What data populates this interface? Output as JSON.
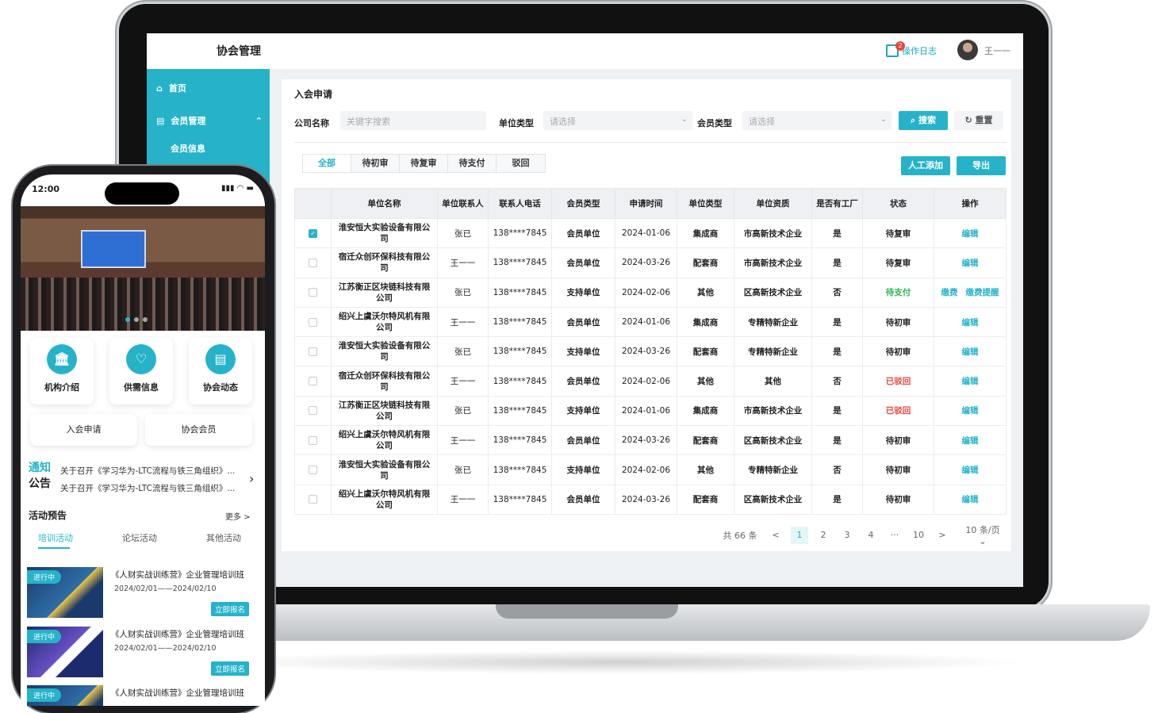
{
  "app": {
    "title": "协会管理",
    "log_label": "操作日志",
    "log_badge": "2",
    "user": "王一一"
  },
  "sidebar": {
    "items": [
      {
        "label": "首页"
      },
      {
        "label": "会员管理"
      }
    ],
    "sub": "会员信息"
  },
  "panel": {
    "title": "入会申请",
    "filters": {
      "company_label": "公司名称",
      "company_placeholder": "关键字搜索",
      "unit_type_label": "单位类型",
      "unit_type_placeholder": "请选择",
      "member_type_label": "会员类型",
      "member_type_placeholder": "请选择"
    },
    "search_label": "搜索",
    "reset_label": "重置",
    "add_label": "人工添加",
    "export_label": "导出",
    "tabs": [
      "全部",
      "待初审",
      "待复审",
      "待支付",
      "驳回"
    ],
    "columns": [
      "单位名称",
      "单位联系人",
      "联系人电话",
      "会员类型",
      "申请时间",
      "单位类型",
      "单位资质",
      "是否有工厂",
      "状态",
      "操作"
    ],
    "rows": [
      {
        "checked": true,
        "name": "淮安恒大实验设备有限公司",
        "contact": "张已",
        "phone": "138****7845",
        "member": "会员单位",
        "date": "2024-01-06",
        "utype": "集成商",
        "qual": "市高新技术企业",
        "factory": "是",
        "status": "待复审",
        "status_color": "",
        "ops": [
          "编辑"
        ]
      },
      {
        "checked": false,
        "name": "宿迁众创环保科技有限公司",
        "contact": "王一一",
        "phone": "138****7845",
        "member": "会员单位",
        "date": "2024-03-26",
        "utype": "配套商",
        "qual": "市高新技术企业",
        "factory": "是",
        "status": "待复审",
        "status_color": "",
        "ops": [
          "编辑"
        ]
      },
      {
        "checked": false,
        "name": "江苏衡正区块链科技有限公司",
        "contact": "张已",
        "phone": "138****7845",
        "member": "支持单位",
        "date": "2024-02-06",
        "utype": "其他",
        "qual": "区高新技术企业",
        "factory": "否",
        "status": "待支付",
        "status_color": "green",
        "ops": [
          "缴费",
          "缴费提醒"
        ]
      },
      {
        "checked": false,
        "name": "绍兴上虞沃尔特风机有限公司",
        "contact": "王一一",
        "phone": "138****7845",
        "member": "会员单位",
        "date": "2024-01-06",
        "utype": "集成商",
        "qual": "专精特新企业",
        "factory": "是",
        "status": "待初审",
        "status_color": "",
        "ops": [
          "编辑"
        ]
      },
      {
        "checked": false,
        "name": "淮安恒大实验设备有限公司",
        "contact": "张已",
        "phone": "138****7845",
        "member": "支持单位",
        "date": "2024-03-26",
        "utype": "配套商",
        "qual": "专精特新企业",
        "factory": "是",
        "status": "待初审",
        "status_color": "",
        "ops": [
          "编辑"
        ]
      },
      {
        "checked": false,
        "name": "宿迁众创环保科技有限公司",
        "contact": "王一一",
        "phone": "138****7845",
        "member": "会员单位",
        "date": "2024-02-06",
        "utype": "其他",
        "qual": "其他",
        "factory": "否",
        "status": "已驳回",
        "status_color": "red",
        "ops": [
          "编辑"
        ]
      },
      {
        "checked": false,
        "name": "江苏衡正区块链科技有限公司",
        "contact": "张已",
        "phone": "138****7845",
        "member": "支持单位",
        "date": "2024-01-06",
        "utype": "集成商",
        "qual": "市高新技术企业",
        "factory": "是",
        "status": "已驳回",
        "status_color": "red",
        "ops": [
          "编辑"
        ]
      },
      {
        "checked": false,
        "name": "绍兴上虞沃尔特风机有限公司",
        "contact": "王一一",
        "phone": "138****7845",
        "member": "会员单位",
        "date": "2024-03-26",
        "utype": "配套商",
        "qual": "区高新技术企业",
        "factory": "是",
        "status": "待初审",
        "status_color": "",
        "ops": [
          "编辑"
        ]
      },
      {
        "checked": false,
        "name": "淮安恒大实验设备有限公司",
        "contact": "张已",
        "phone": "138****7845",
        "member": "支持单位",
        "date": "2024-02-06",
        "utype": "其他",
        "qual": "专精特新企业",
        "factory": "否",
        "status": "待初审",
        "status_color": "",
        "ops": [
          "编辑"
        ]
      },
      {
        "checked": false,
        "name": "绍兴上虞沃尔特风机有限公司",
        "contact": "王一一",
        "phone": "138****7845",
        "member": "会员单位",
        "date": "2024-03-26",
        "utype": "配套商",
        "qual": "区高新技术企业",
        "factory": "是",
        "status": "待初审",
        "status_color": "",
        "ops": [
          "编辑"
        ]
      }
    ],
    "pager": {
      "total": "共 66 条",
      "prev": "<",
      "pages": [
        "1",
        "2",
        "3",
        "4",
        "···",
        "10"
      ],
      "next": ">",
      "size": "10 条/页"
    }
  },
  "phone": {
    "time": "12:00",
    "quick": [
      {
        "label": "机构介绍"
      },
      {
        "label": "供需信息"
      },
      {
        "label": "协会动态"
      }
    ],
    "links": [
      "入会申请",
      "协会会员"
    ],
    "notice": {
      "word1": "通知",
      "word2": "公告",
      "lines": [
        "关于召开《学习华为-LTC流程与铁三角组织》...",
        "关于召开《学习华为-LTC流程与铁三角组织》..."
      ]
    },
    "section": "活动预告",
    "more": "更多 >",
    "tabs": [
      "培训活动",
      "论坛活动",
      "其他活动"
    ],
    "activities": [
      {
        "tag": "进行中",
        "title": "《人财实战训练营》企业管理培训班",
        "date": "2024/02/01——2024/02/10",
        "button": "立即报名"
      },
      {
        "tag": "进行中",
        "title": "《人财实战训练营》企业管理培训班",
        "date": "2024/02/01——2024/02/10",
        "button": "立即报名"
      },
      {
        "tag": "进行中",
        "title": "《人财实战训练营》企业管理培训班",
        "date": "",
        "button": ""
      }
    ]
  }
}
